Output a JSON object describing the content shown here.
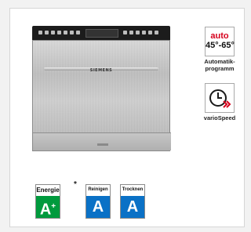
{
  "product": {
    "brand": "SIEMENS"
  },
  "features": [
    {
      "icon": "thermometer-auto-icon",
      "title_top": "auto",
      "title_bottom": "45°-65°",
      "label_line1": "Automatik-",
      "label_line2": "programm"
    },
    {
      "icon": "clock-speed-icon",
      "label_line1": "varioSpeed"
    }
  ],
  "labels": {
    "energie": {
      "name": "Energie",
      "grade": "A",
      "grade_sup": "+",
      "asterisk": "*"
    },
    "reinigen": {
      "name": "Reinigen",
      "grade": "A"
    },
    "trocknen": {
      "name": "Trocknen",
      "grade": "A"
    }
  },
  "colors": {
    "energy_green": "#009a3d",
    "class_blue": "#0a71c6",
    "accent_red": "#d6001c"
  }
}
